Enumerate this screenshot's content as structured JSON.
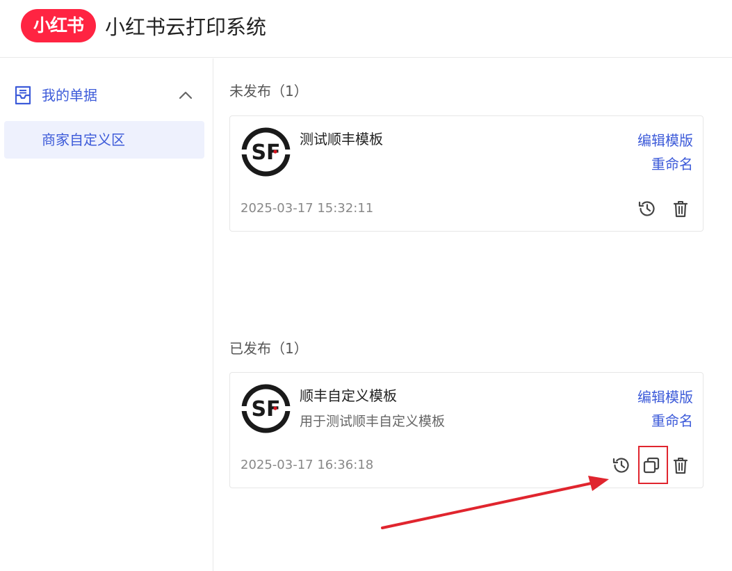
{
  "header": {
    "logo_text": "小红书",
    "app_title": "小红书云打印系统"
  },
  "sidebar": {
    "group_label": "我的单据",
    "sub_item_label": "商家自定义区"
  },
  "sections": {
    "unpublished_title": "未发布（1）",
    "published_title": "已发布（1）"
  },
  "cards": [
    {
      "name": "测试顺丰模板",
      "description": "",
      "time": "2025-03-17 15:32:11",
      "edit_label": "编辑模版",
      "rename_label": "重命名",
      "logo_text": "SF"
    },
    {
      "name": "顺丰自定义模板",
      "description": "用于测试顺丰自定义模板",
      "time": "2025-03-17 16:36:18",
      "edit_label": "编辑模版",
      "rename_label": "重命名",
      "logo_text": "SF"
    }
  ],
  "colors": {
    "brand": "#ff2442",
    "accent": "#3d5bd9",
    "annotation": "#e0252e"
  }
}
